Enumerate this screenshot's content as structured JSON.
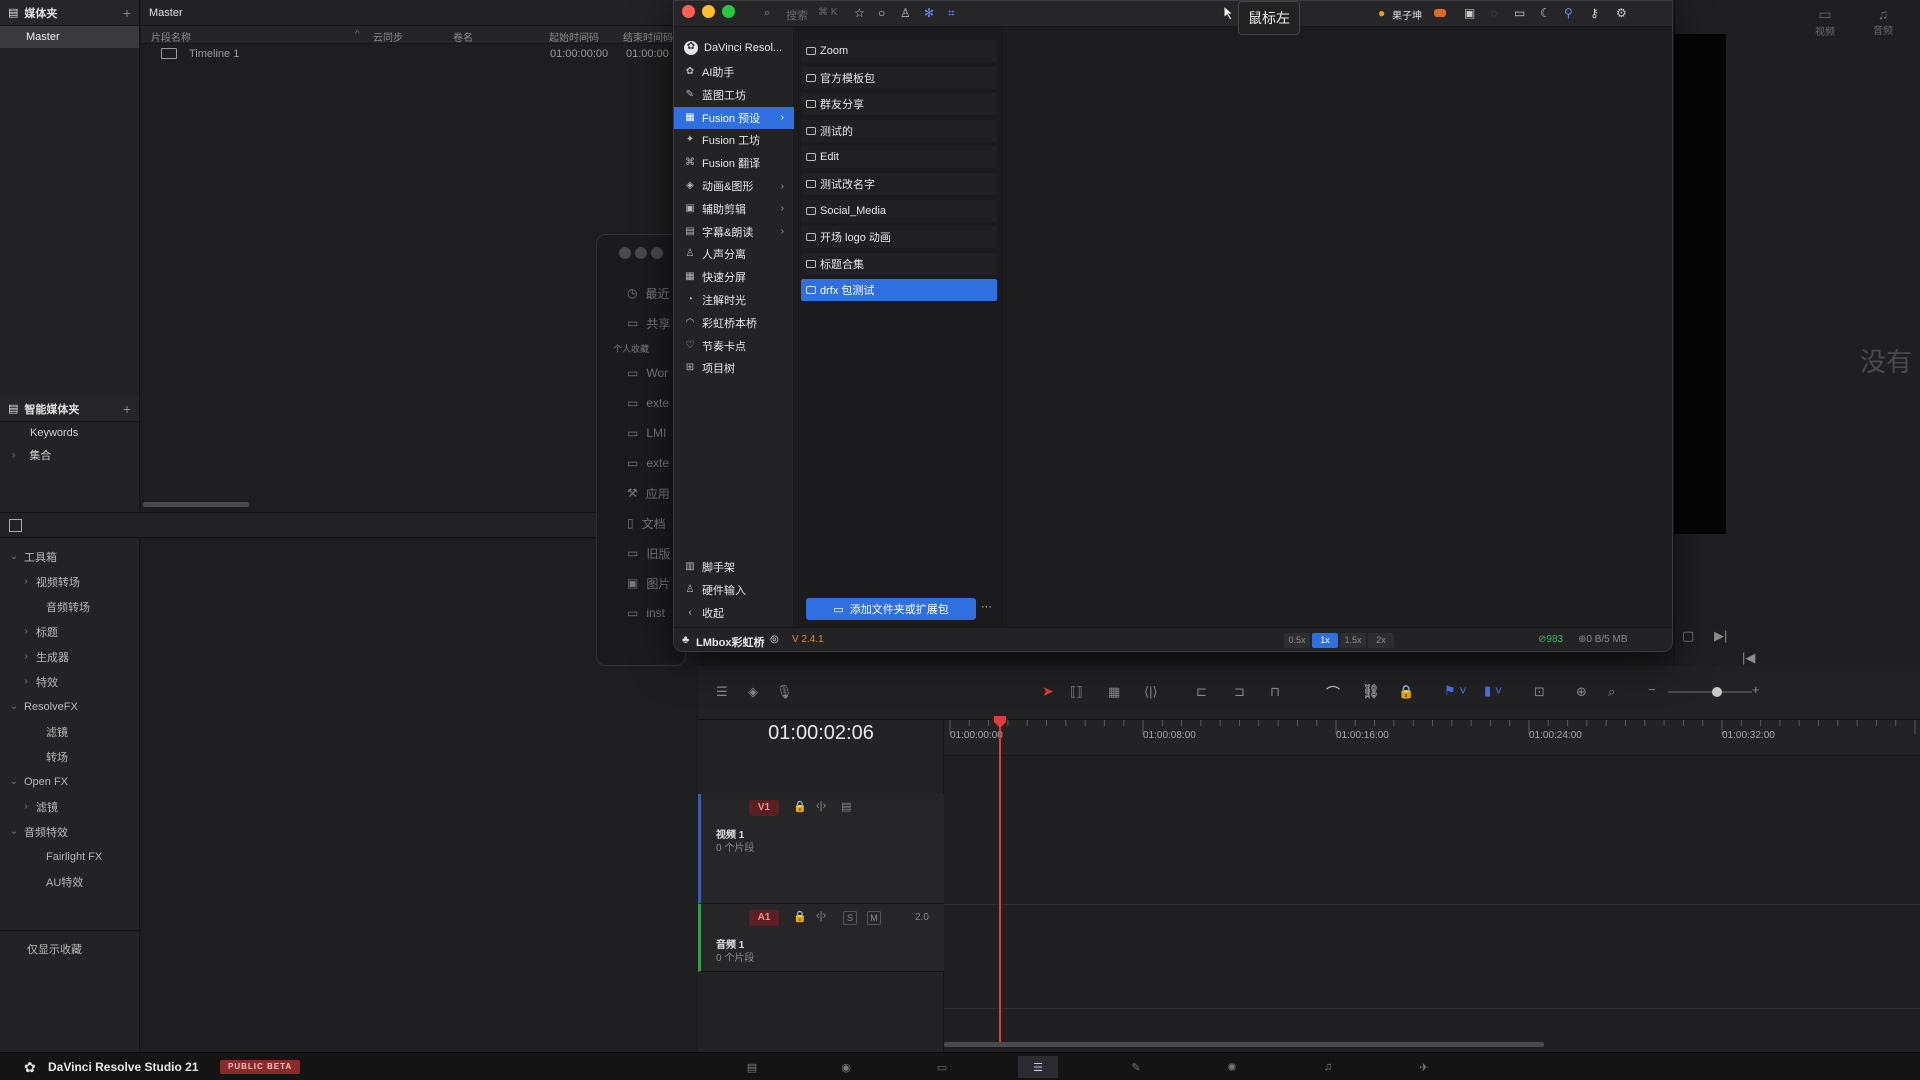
{
  "media_pool": {
    "bins_title": "媒体夹",
    "bins": [
      "Master"
    ],
    "smart_bins_title": "智能媒体夹",
    "smart_bins": [
      "Keywords",
      "集合"
    ],
    "list_title": "Master",
    "columns": [
      "片段名称",
      "云同步",
      "卷名",
      "起始时间码",
      "结束时间码"
    ],
    "clips": [
      {
        "name": "Timeline 1",
        "start": "01:00:00:00",
        "end": "01:00:00"
      }
    ]
  },
  "effects": {
    "tree": [
      {
        "label": "工具箱",
        "level": 0,
        "expanded": true
      },
      {
        "label": "视频转场",
        "level": 1,
        "expanded": false
      },
      {
        "label": "音频转场",
        "level": 2
      },
      {
        "label": "标题",
        "level": 1,
        "expanded": false
      },
      {
        "label": "生成器",
        "level": 1,
        "expanded": false
      },
      {
        "label": "特效",
        "level": 1,
        "expanded": false
      },
      {
        "label": "ResolveFX",
        "level": 0,
        "expanded": true
      },
      {
        "label": "滤镜",
        "level": 2
      },
      {
        "label": "转场",
        "level": 2
      },
      {
        "label": "Open FX",
        "level": 0,
        "expanded": true
      },
      {
        "label": "滤镜",
        "level": 1,
        "expanded": false
      },
      {
        "label": "音频特效",
        "level": 0,
        "expanded": true
      },
      {
        "label": "Fairlight FX",
        "level": 2
      },
      {
        "label": "AU特效",
        "level": 2
      }
    ],
    "favorites_toggle": "仅显示收藏"
  },
  "behind_window": {
    "items": [
      "最近",
      "共享",
      "个人收藏",
      "Wor",
      "exte",
      "LMI",
      "exte",
      "应用",
      "文档",
      "旧版",
      "图片",
      "inst"
    ]
  },
  "plugin": {
    "search_placeholder": "搜索",
    "search_shortcut": "⌘ K",
    "user_name": "果子坤",
    "side_header": "DaVinci Resol...",
    "side_items": [
      {
        "label": "AI助手",
        "icon": "✿",
        "chevron": false
      },
      {
        "label": "蓝图工坊",
        "icon": "✎",
        "chevron": false
      },
      {
        "label": "Fusion 预设",
        "icon": "▦",
        "chevron": true,
        "selected": true
      },
      {
        "label": "Fusion 工坊",
        "icon": "✦",
        "chevron": false
      },
      {
        "label": "Fusion 翻译",
        "icon": "⌘",
        "chevron": false
      },
      {
        "label": "动画&图形",
        "icon": "◈",
        "chevron": true
      },
      {
        "label": "辅助剪辑",
        "icon": "▣",
        "chevron": true
      },
      {
        "label": "字幕&朗读",
        "icon": "▤",
        "chevron": true
      },
      {
        "label": "人声分离",
        "icon": "♙",
        "chevron": false
      },
      {
        "label": "快速分屏",
        "icon": "▦",
        "chevron": false
      },
      {
        "label": "注解时光",
        "icon": "◔",
        "chevron": false
      },
      {
        "label": "彩虹桥本桥",
        "icon": "◠",
        "chevron": false
      },
      {
        "label": "节奏卡点",
        "icon": "♡",
        "chevron": false
      },
      {
        "label": "项目树",
        "icon": "⊞",
        "chevron": false
      }
    ],
    "side_bottom": [
      {
        "label": "脚手架",
        "icon": "▥"
      },
      {
        "label": "硬件输入",
        "icon": "♙"
      },
      {
        "label": "收起",
        "icon": "‹"
      }
    ],
    "list_items": [
      {
        "label": "Zoom"
      },
      {
        "label": "官方模板包"
      },
      {
        "label": "群友分享"
      },
      {
        "label": "测试的"
      },
      {
        "label": "Edit"
      },
      {
        "label": "测试改名字"
      },
      {
        "label": "Social_Media"
      },
      {
        "label": "开场 logo 动画"
      },
      {
        "label": "标题合集"
      },
      {
        "label": "drfx 包测试",
        "selected": true
      }
    ],
    "add_button": "添加文件夹或扩展包",
    "more_button": "···",
    "brand": "LMbox彩虹桥",
    "version": "V 2.4.1",
    "speeds": [
      "0.5x",
      "1x",
      "1.5x",
      "2x"
    ],
    "active_speed": "1x",
    "ok_count": "983",
    "traffic": "0 B/5 MB"
  },
  "tooltip": "鼠标左",
  "viewer": {
    "tabs": [
      "视频",
      "音频"
    ],
    "no_clip_text": "没有"
  },
  "timeline": {
    "timecode": "01:00:02:06",
    "ruler": [
      "01:00:00:00",
      "01:00:08:00",
      "01:00:16:00",
      "01:00:24:00",
      "01:00:32:00"
    ],
    "tracks": [
      {
        "id": "V1",
        "name": "视频 1",
        "clips": "0 个片段"
      },
      {
        "id": "A1",
        "name": "音频 1",
        "clips": "0 个片段",
        "level": "2.0",
        "solo": "S",
        "mute": "M"
      }
    ]
  },
  "app": {
    "name": "DaVinci Resolve Studio 21",
    "badge": "PUBLIC BETA"
  },
  "colors": {
    "accent": "#2f6fe0",
    "playhead": "#e03a3a",
    "track_chip": "#5a1f22"
  }
}
